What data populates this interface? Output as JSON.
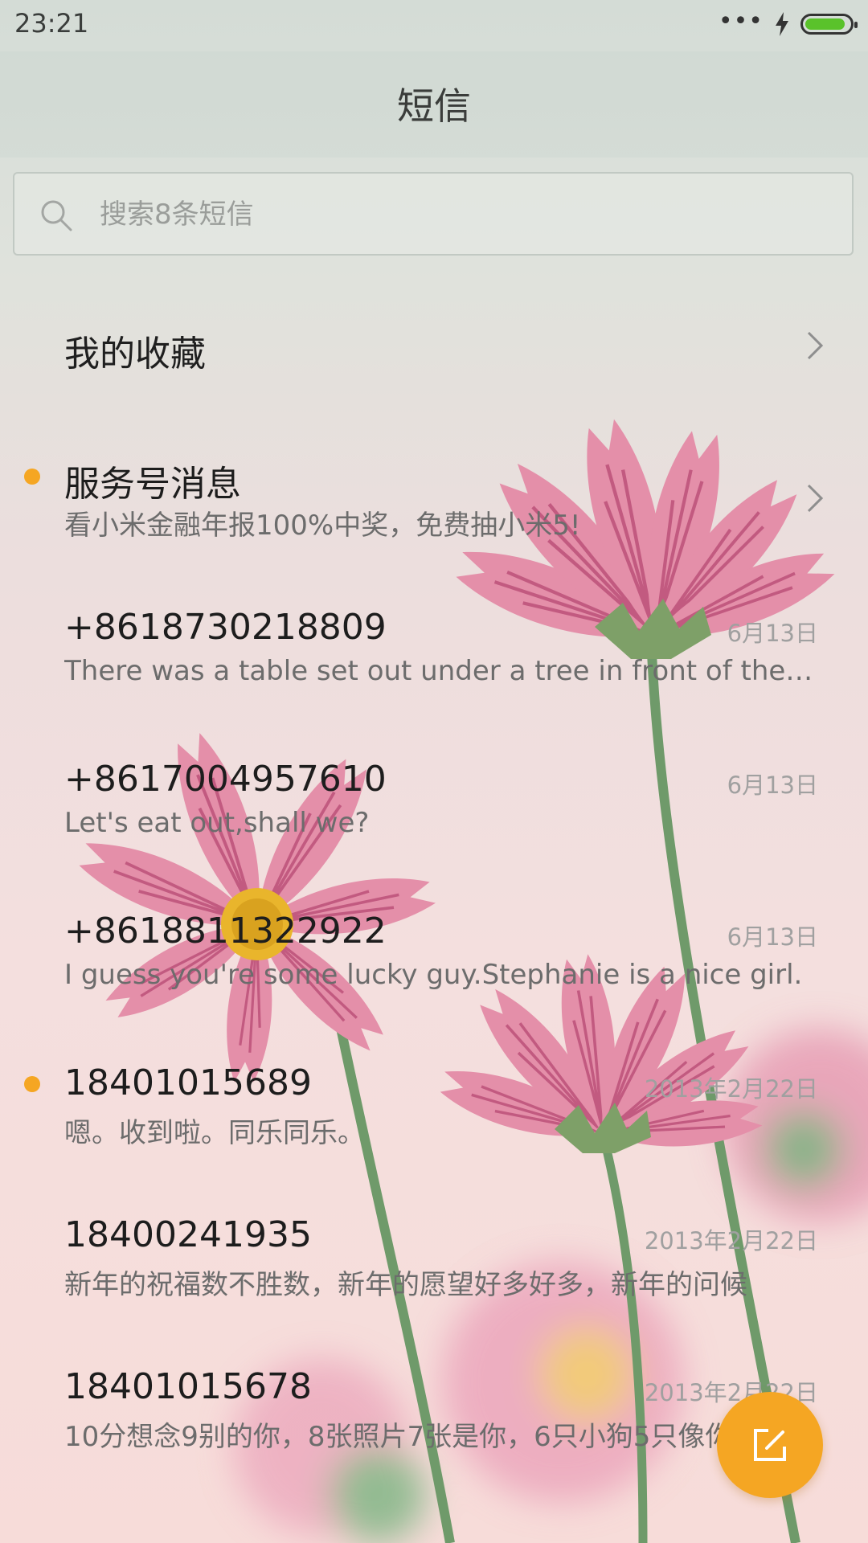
{
  "status_bar": {
    "time": "23:21",
    "signal_icon": "more-dots-icon",
    "charging_icon": "charging-bolt-icon",
    "battery_level": 0.9,
    "battery_color": "#5ac22b"
  },
  "header": {
    "title": "短信"
  },
  "search": {
    "placeholder": "搜索8条短信",
    "value": "",
    "icon": "search-icon"
  },
  "favorites": {
    "label": "我的收藏",
    "icon": "chevron-right-icon"
  },
  "conversations": [
    {
      "sender": "服务号消息",
      "date": "",
      "preview": "看小米金融年报100%中奖，免费抽小米5!",
      "unread": true,
      "has_chevron": true
    },
    {
      "sender": "+8618730218809",
      "date": "6月13日",
      "preview": "There was a table set out under a tree in front of the house",
      "unread": false
    },
    {
      "sender": "+8617004957610",
      "date": "6月13日",
      "preview": "Let's eat out,shall we?",
      "unread": false
    },
    {
      "sender": "+8618811322922",
      "date": "6月13日",
      "preview": "I guess you're some lucky guy.Stephanie is a nice girl.",
      "unread": false
    },
    {
      "sender": "18401015689",
      "date": "2013年2月22日",
      "preview": "嗯。收到啦。同乐同乐。",
      "unread": true
    },
    {
      "sender": "18400241935",
      "date": "2013年2月22日",
      "preview": "新年的祝福数不胜数，新年的愿望好多好多，新年的问候",
      "unread": false
    },
    {
      "sender": "18401015678",
      "date": "2013年2月22日",
      "preview": "10分想念9别的你，8张照片7张是你，6只小狗5只像你",
      "unread": false
    }
  ],
  "compose_button": {
    "icon": "compose-icon",
    "color": "#f5a623"
  },
  "colors": {
    "accent": "#f5a623",
    "unread_dot": "#f5a623"
  }
}
